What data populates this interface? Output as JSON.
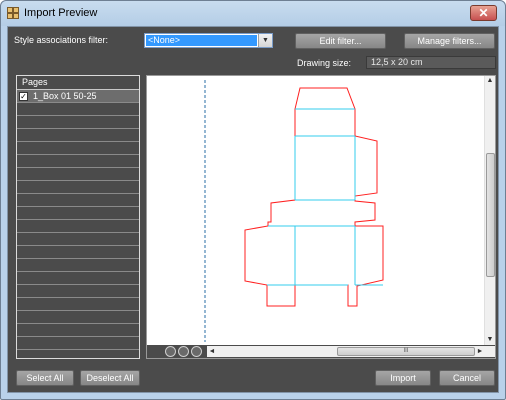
{
  "window": {
    "title": "Import Preview",
    "close_glyph": "✕"
  },
  "filter": {
    "label": "Style associations filter:",
    "value": "<None>",
    "edit_label": "Edit filter...",
    "manage_label": "Manage filters..."
  },
  "drawing": {
    "label": "Drawing size:",
    "value": "12,5 x 20 cm"
  },
  "pages": {
    "header": "Pages",
    "items": [
      {
        "name": "1_Box 01 50-25",
        "checked": true
      }
    ]
  },
  "preview": {
    "zoom_icons": [
      "zoom-fit-icon",
      "zoom-in-icon",
      "zoom-out-icon"
    ],
    "hscroll_grip": "III",
    "vscroll_grip": "≡",
    "colors": {
      "cut": "#ff2020",
      "fold": "#33ccee",
      "guide": "#2a6ea6"
    }
  },
  "buttons": {
    "select_all": "Select All",
    "deselect_all": "Deselect All",
    "import": "Import",
    "cancel": "Cancel"
  }
}
